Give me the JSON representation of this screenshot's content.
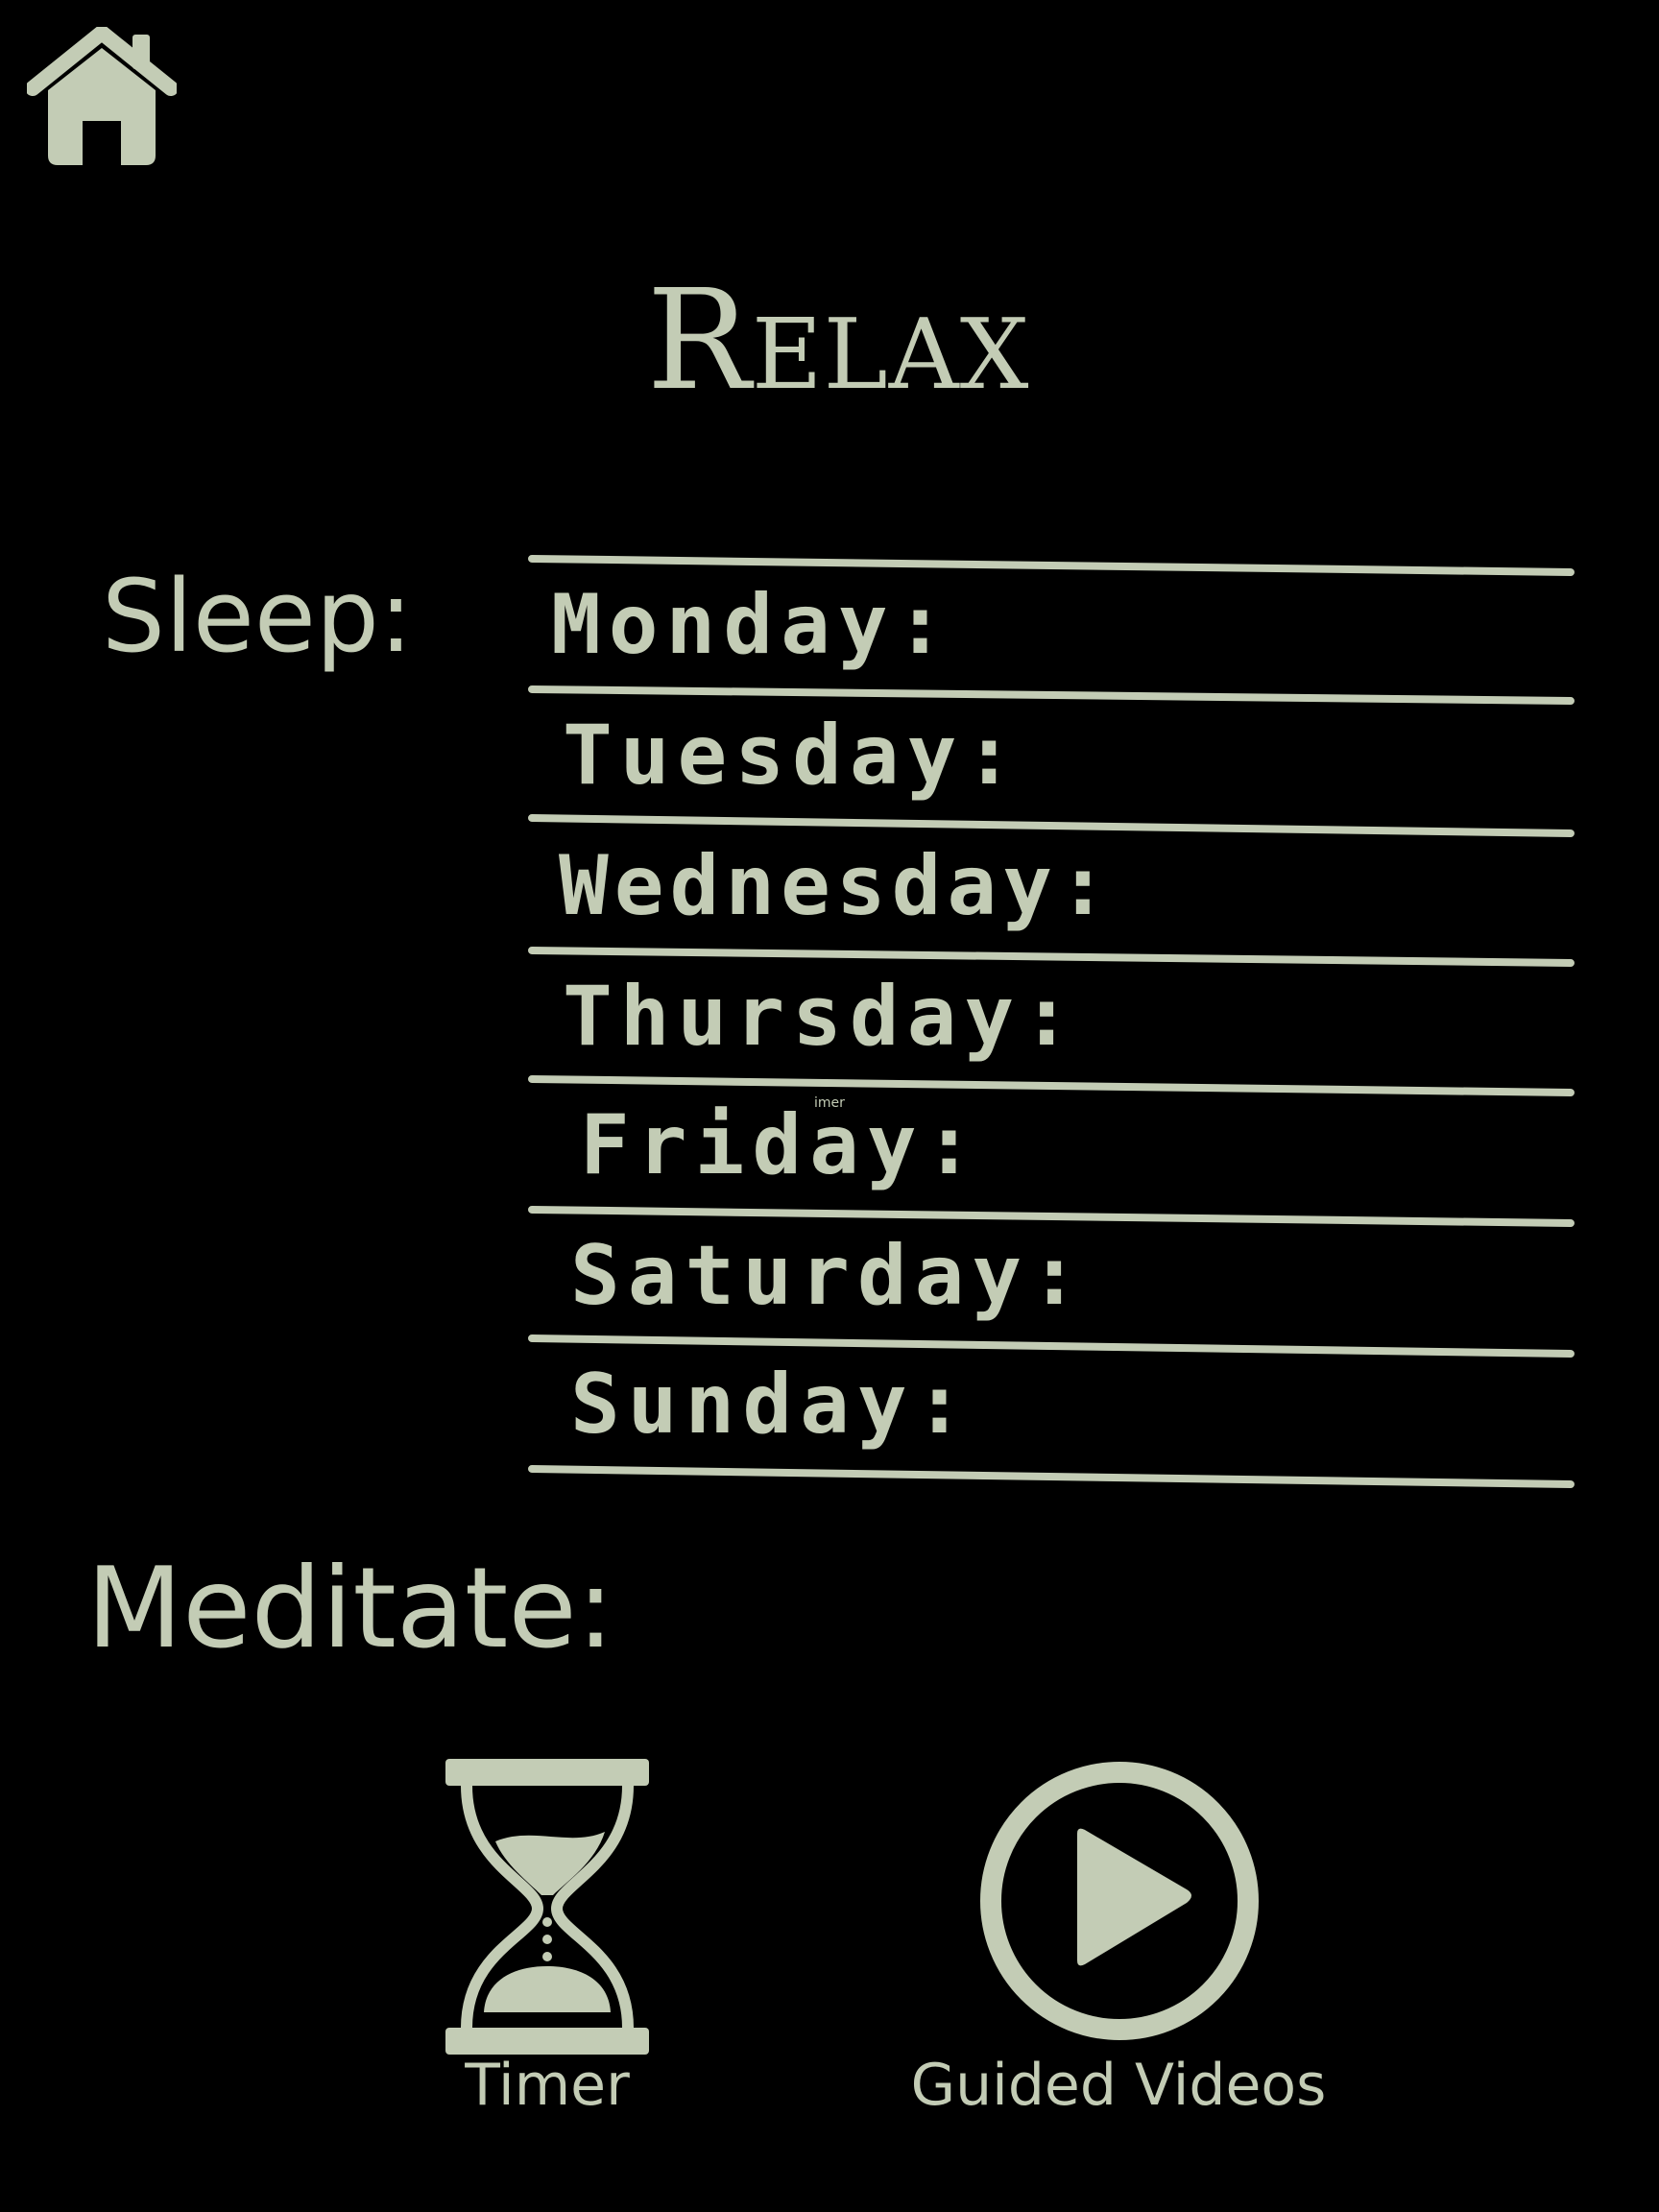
{
  "colors": {
    "background": "#000000",
    "accent": "#c3ccb5"
  },
  "header": {
    "home_icon": "home-icon",
    "title": "Relax"
  },
  "sleep": {
    "label": "Sleep:",
    "days": [
      {
        "label": "Monday:"
      },
      {
        "label": "Tuesday:"
      },
      {
        "label": "Wednesday:"
      },
      {
        "label": "Thursday:"
      },
      {
        "label": "Friday:"
      },
      {
        "label": "Saturday:"
      },
      {
        "label": "Sunday:"
      }
    ],
    "stray_text": "imer"
  },
  "meditate": {
    "label": "Meditate:",
    "timer": {
      "icon": "hourglass-icon",
      "label": "Timer"
    },
    "guided_videos": {
      "icon": "play-circle-icon",
      "label": "Guided Videos"
    }
  }
}
